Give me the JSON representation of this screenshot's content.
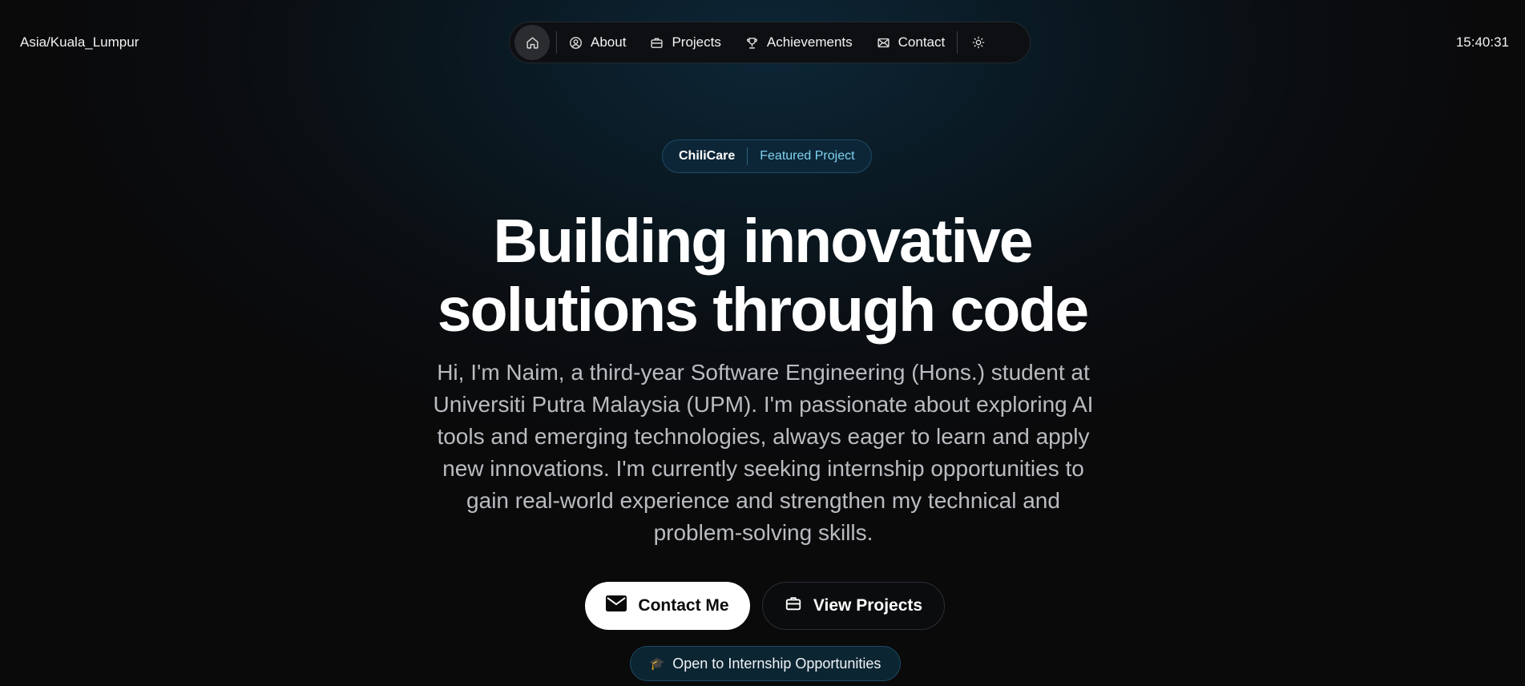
{
  "header": {
    "timezone": "Asia/Kuala_Lumpur",
    "clock": "15:40:31"
  },
  "nav": {
    "items": [
      {
        "label": "About",
        "icon": "user-circle-icon"
      },
      {
        "label": "Projects",
        "icon": "briefcase-icon"
      },
      {
        "label": "Achievements",
        "icon": "trophy-icon"
      },
      {
        "label": "Contact",
        "icon": "mail-icon"
      }
    ],
    "home_icon": "home-icon",
    "theme_icon": "sun-icon"
  },
  "hero": {
    "badge_name": "ChiliCare",
    "badge_label": "Featured Project",
    "headline_line1": "Building innovative",
    "headline_line2": "solutions through code",
    "intro": "Hi, I'm Naim, a third-year Software Engineering (Hons.) student at Universiti Putra Malaysia (UPM). I'm passionate about exploring AI tools and emerging technologies, always eager to learn and apply new innovations. I'm currently seeking internship opportunities to gain real-world experience and strengthen my technical and problem-solving skills.",
    "contact_label": "Contact Me",
    "projects_label": "View Projects",
    "status_text": "Open to Internship Opportunities"
  },
  "colors": {
    "accent": "#7fd3ee",
    "background": "#0a0a0b",
    "badge_bg": "#0c2638"
  }
}
